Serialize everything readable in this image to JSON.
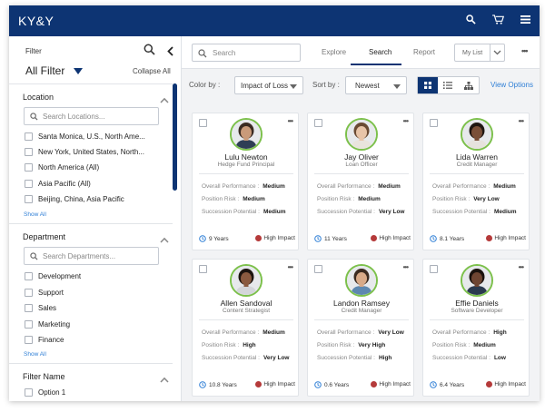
{
  "app": {
    "logo": "KY&Y"
  },
  "sidebar": {
    "title": "Filter",
    "all_filter": "All Filter",
    "collapse_all": "Collapse All",
    "location": {
      "heading": "Location",
      "placeholder": "Search Locations...",
      "options": [
        "Santa Monica, U.S., North Ame...",
        "New York, United States, North...",
        "North America (All)",
        "Asia Pacific (All)",
        "Beijing, China, Asia Pacific"
      ],
      "show_all": "Show All"
    },
    "department": {
      "heading": "Department",
      "placeholder": "Search Departments...",
      "options": [
        "Development",
        "Support",
        "Sales",
        "Marketing",
        "Finance"
      ],
      "show_all": "Show All"
    },
    "filter_name": {
      "heading": "Filter Name",
      "options": [
        "Option 1"
      ]
    }
  },
  "toolbar": {
    "search_placeholder": "Search",
    "tabs": [
      "Explore",
      "Search",
      "Report"
    ],
    "active_tab": "Search",
    "my_list": "My List",
    "color_by_label": "Color by :",
    "color_by_value": "Impact of Loss",
    "sort_by_label": "Sort by :",
    "sort_by_value": "Newest",
    "view_options": "View Options"
  },
  "metric_labels": {
    "performance": "Overall Performance :",
    "risk": "Position Risk :",
    "succession": "Succession Potential :"
  },
  "cards": [
    {
      "name": "Lulu Newton",
      "title": "Hedge Fund Principal",
      "performance": "Medium",
      "risk": "Medium",
      "succession": "Medium",
      "years": "9 Years",
      "impact": "High Impact",
      "skin": "#c99a7a",
      "hair": "#3a2a22",
      "shirt": "#2f3e55"
    },
    {
      "name": "Jay Oliver",
      "title": "Loan Officer",
      "performance": "Medium",
      "risk": "Medium",
      "succession": "Very Low",
      "years": "11 Years",
      "impact": "High Impact",
      "skin": "#e8c4a8",
      "hair": "#6a4a33",
      "shirt": "#e9e4dc"
    },
    {
      "name": "Lida Warren",
      "title": "Credit Manager",
      "performance": "Medium",
      "risk": "Very Low",
      "succession": "Medium",
      "years": "8.1 Years",
      "impact": "High Impact",
      "skin": "#7a4f38",
      "hair": "#1f1612",
      "shirt": "#e6e2dd"
    },
    {
      "name": "Allen Sandoval",
      "title": "Content Strategist",
      "performance": "Medium",
      "risk": "High",
      "succession": "Very Low",
      "years": "10.8 Years",
      "impact": "High Impact",
      "skin": "#8a5a40",
      "hair": "#1c1410",
      "shirt": "#d4d6da"
    },
    {
      "name": "Landon Ramsey",
      "title": "Credit Manager",
      "performance": "Very Low",
      "risk": "Very High",
      "succession": "High",
      "years": "0.6 Years",
      "impact": "High Impact",
      "skin": "#d8aa88",
      "hair": "#3b2b20",
      "shirt": "#5e88b0"
    },
    {
      "name": "Effie Daniels",
      "title": "Software Developer",
      "performance": "High",
      "risk": "Medium",
      "succession": "Low",
      "years": "6.4 Years",
      "impact": "High Impact",
      "skin": "#6e4532",
      "hair": "#1a120e",
      "shirt": "#2b3a4f"
    }
  ],
  "colors": {
    "brand": "#0d3473",
    "accent_green": "#7cc04b",
    "impact_red": "#b53a3a",
    "link_blue": "#2f7fd6"
  },
  "icons": {
    "search": "search-icon",
    "cart": "cart-icon",
    "menu": "hamburger-menu-icon",
    "collapse": "chevron-left-icon",
    "section_toggle": "chevron-up-icon",
    "years": "clock-icon",
    "views": [
      "grid-view-icon",
      "list-view-icon",
      "org-chart-icon"
    ]
  }
}
